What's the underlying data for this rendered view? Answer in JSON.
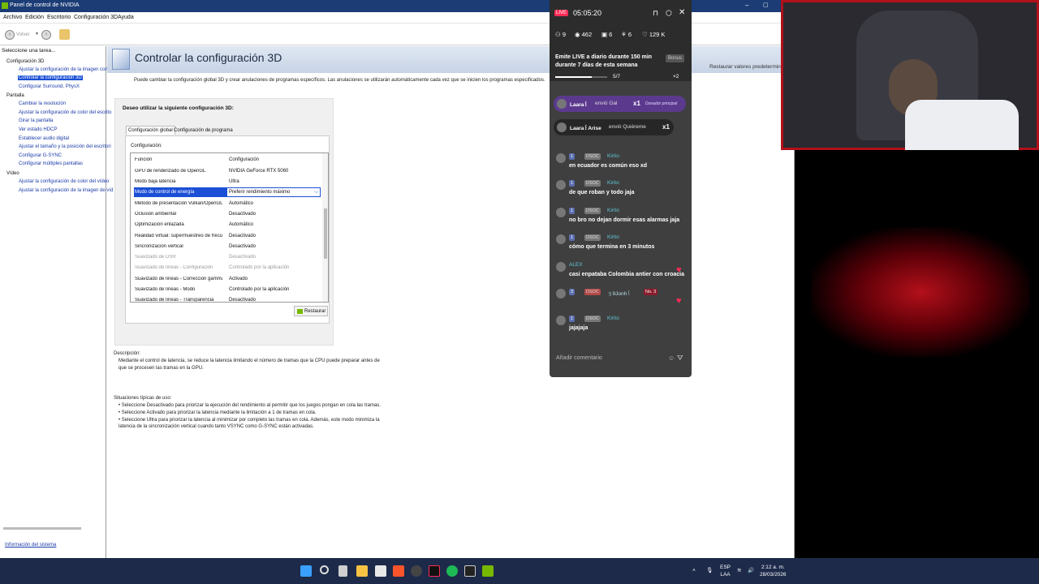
{
  "window": {
    "title": "Panel de control de NVIDIA",
    "menu": [
      "Archivo",
      "Edición",
      "Escritorio",
      "Configuración 3D",
      "Ayuda"
    ],
    "back_label": "Volver"
  },
  "sidebar": {
    "header": "Seleccione una tarea...",
    "items": [
      "Configuración 3D",
      "Ajustar la configuración de la imagen con v",
      "Controlar la configuración 3D",
      "Configurar Surround, PhysX",
      "Pantalla",
      "Cambiar la resolución",
      "Ajustar la configuración de color del escrito",
      "Girar la pantalla",
      "Ver estado HDCP",
      "Establecer audio digital",
      "Ajustar el tamaño y la posición del escritori",
      "Configurar G-SYNC",
      "Configurar múltiples pantallas",
      "Vídeo",
      "Ajustar la configuración de color del vídeo",
      "Ajustar la configuración de la imagen de víd"
    ],
    "system_info": "Información del sistema"
  },
  "main": {
    "title": "Controlar la configuración 3D",
    "restore_defaults": "Restaurar valores predeterminad",
    "intro": "Puede cambiar la configuración global 3D y crear anulaciones de programas específicos. Las anulaciones se utilizarán automáticamente cada vez que se inicien los programas especificados.",
    "question": "Deseo utilizar la siguiente configuración 3D:",
    "tabs": [
      "Configuración global",
      "Configuración de programa"
    ],
    "config_label": "Configuración:",
    "table_headers": [
      "Función",
      "Configuración"
    ],
    "rows": [
      [
        "GPU de renderizado de OpenGL",
        "NVIDIA GeForce RTX 5060"
      ],
      [
        "Modo baja latencia",
        "Ultra"
      ],
      [
        "Modo de control de energía",
        "Preferir rendimiento máximo"
      ],
      [
        "Método de presentación Vulkan/OpenGL",
        "Automático"
      ],
      [
        "Oclusión ambiental",
        "Desactivado"
      ],
      [
        "Optimización enlazada",
        "Automático"
      ],
      [
        "Realidad virtual: supermuestreo de frecue...",
        "Desactivado"
      ],
      [
        "Sincronización vertical",
        "Desactivado"
      ],
      [
        "Suavizado de DSR",
        "Desactivado"
      ],
      [
        "Suavizado de líneas - Configuración",
        "Controlado por la aplicación"
      ],
      [
        "Suavizado de líneas - Corrección gamma",
        "Activado"
      ],
      [
        "Suavizado de líneas - Modo",
        "Controlado por la aplicación"
      ],
      [
        "Suavizado de líneas - Transparencia",
        "Desactivado"
      ]
    ],
    "restore_button": "Restaurar",
    "description_title": "Descripción:",
    "description_lines": [
      "Mediante el control de latencia, se reduce la latencia limitando el número de tramas que la CPU puede preparar antes de",
      "que se procesen las tramas en la GPU."
    ],
    "usage_title": "Situaciones típicas de uso:",
    "usage_lines": [
      "• Seleccione Desactivado para priorizar la ejecución del rendimiento al permitir que los juegos pongan en cola las tramas.",
      "• Seleccione Activado para priorizar la latencia mediante la limitación a 1 de tramas en cola.",
      "• Seleccione Ultra para priorizar la latencia al minimizar por completo las tramas en cola. Además, este modo minimiza la",
      "latencia de la sincronización vertical cuando tanto VSYNC como G-SYNC están activadas."
    ]
  },
  "live": {
    "badge": "LIVE",
    "time": "05:05:20",
    "stats": [
      "9",
      "462",
      "6",
      "6",
      "129 K"
    ],
    "goal_line1": "Emite LIVE a diario durante 150 min",
    "goal_line2": "durante 7 días de esta semana",
    "bonus": "Bonus",
    "progress_text": "5/7",
    "progress_fraction": 0.71,
    "gift_multiplier_top": "×2",
    "gifts": [
      {
        "user": "Laara꒰",
        "action": "envió Gal",
        "count": "x1",
        "badge": "Donador principal"
      },
      {
        "user": "Laara꒰Arise",
        "action": "envió Quiéreme",
        "count": "x1"
      }
    ],
    "messages": [
      {
        "level": "1",
        "tag": "DSOC",
        "user": "Kirito",
        "text": "en ecuador es común eso xd"
      },
      {
        "level": "1",
        "tag": "DSOC",
        "user": "Kirito",
        "text": "de que roban y todo jaja"
      },
      {
        "level": "1",
        "tag": "DSOC",
        "user": "Kirito",
        "text": "no bro no dejan dormir esas alarmas jaja"
      },
      {
        "level": "1",
        "tag": "DSOC",
        "user": "Kirito",
        "text": "cómo que termina en 3 minutos"
      },
      {
        "level": "",
        "tag": "",
        "user": "ALEX",
        "text": "casi enpataba Colombia antier con croacia"
      },
      {
        "level": "3",
        "tag": "DSOC",
        "user": "ぅ9Jonh꒰",
        "text": "",
        "rank": "No. 3"
      },
      {
        "level": "1",
        "tag": "DSOC",
        "user": "Kirito",
        "text": "jajajaja"
      }
    ],
    "comment_placeholder": "Añadir comentario"
  },
  "taskbar": {
    "lang_line1": "ESP",
    "lang_line2": "LAA",
    "time": "2:12 a. m.",
    "date": "28/03/2026"
  }
}
